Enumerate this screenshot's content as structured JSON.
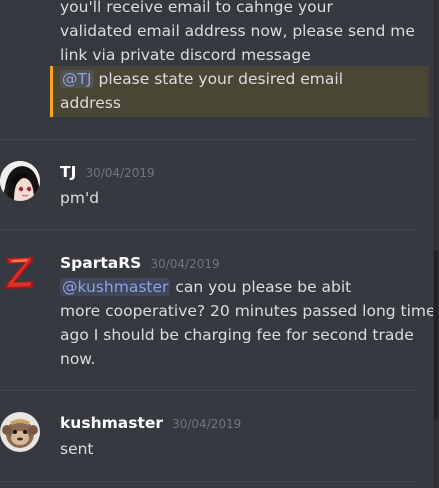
{
  "messages": {
    "continuation": {
      "lines": [
        "you'll receive email to cahnge your",
        "validated email address now, please send me",
        "link via private discord message"
      ],
      "mention_label": "@TJ",
      "mention_text": "please state your desired email",
      "mention_text_line2": "address"
    },
    "tj": {
      "username": "TJ",
      "timestamp": "30/04/2019",
      "text": "pm'd"
    },
    "spartars": {
      "username": "SpartaRS",
      "timestamp": "30/04/2019",
      "mention_label": "@kushmaster",
      "line1_text": "can you please be abit",
      "lines": [
        "more cooperative? 20 minutes passed long time",
        "ago I should be charging fee for second trade",
        "now."
      ]
    },
    "kushmaster": {
      "username": "kushmaster",
      "timestamp": "30/04/2019",
      "text": "sent"
    }
  },
  "colors": {
    "background": "#36393f",
    "highlight": "#4a4636",
    "highlight_bar": "#faa61a",
    "mention": "#8ea1e1",
    "username": "#ffffff",
    "timestamp": "#72767d",
    "text": "#dcddde"
  }
}
